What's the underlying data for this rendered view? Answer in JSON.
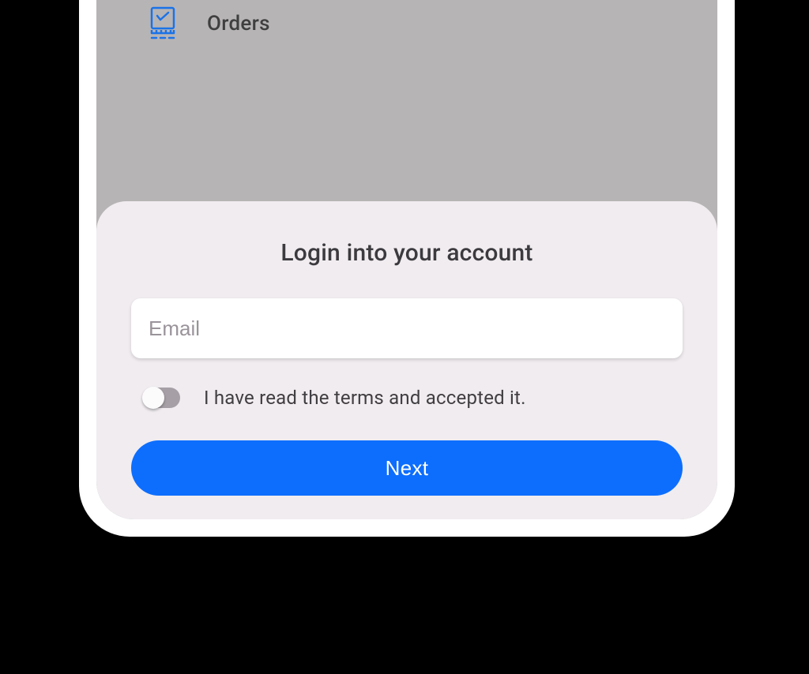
{
  "background": {
    "nav_item_label": "Orders"
  },
  "sheet": {
    "title": "Login into your account",
    "email_placeholder": "Email",
    "terms_label": "I have read the terms and accepted it.",
    "terms_accepted": false,
    "next_label": "Next"
  },
  "colors": {
    "accent": "#0d6efd",
    "icon": "#1a73e8",
    "sheet_bg": "#f0ecf0",
    "screen_bg": "#b7b4b5"
  }
}
